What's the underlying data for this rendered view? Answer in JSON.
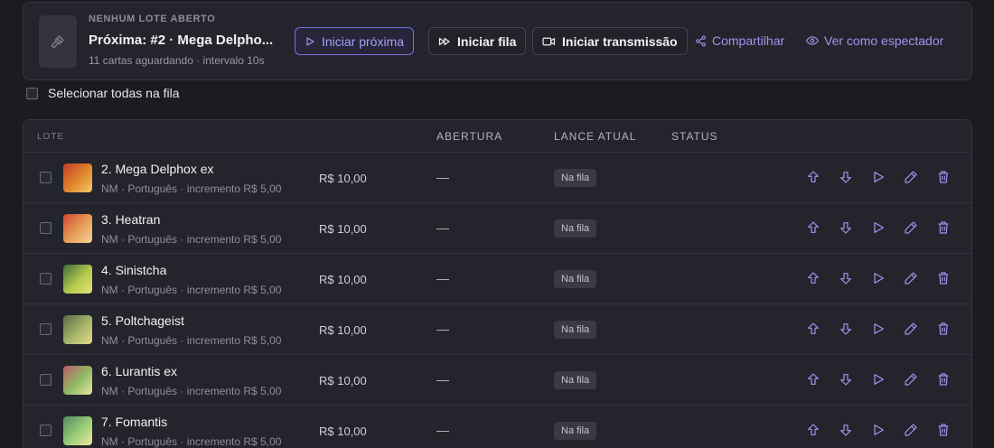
{
  "header": {
    "status_kicker": "NENHUM LOTE ABERTO",
    "next_title": "Próxima: #2 · Mega Delpho...",
    "queue_info": "11 cartas aguardando · intervalo 10s",
    "buttons": {
      "start_next": "Iniciar próxima",
      "start_queue": "Iniciar fila",
      "start_stream": "Iniciar transmissão"
    },
    "links": {
      "share": "Compartilhar",
      "view_as_viewer": "Ver como espectador"
    }
  },
  "select_all_label": "Selecionar todas na fila",
  "table": {
    "headers": {
      "lote": "LOTE",
      "abertura": "ABERTURA",
      "lance_atual": "LANCE ATUAL",
      "status": "STATUS"
    },
    "rows": [
      {
        "name": "2. Mega Delphox ex",
        "meta": "NM · Português · incremento R$ 5,00",
        "price": "R$ 10,00",
        "opening": "—",
        "status": "Na fila",
        "thumb_colors": [
          "#c23b2a",
          "#e08a2c",
          "#f3c96b"
        ]
      },
      {
        "name": "3. Heatran",
        "meta": "NM · Português · incremento R$ 5,00",
        "price": "R$ 10,00",
        "opening": "—",
        "status": "Na fila",
        "thumb_colors": [
          "#d1472f",
          "#e7a05a",
          "#f2d39a"
        ]
      },
      {
        "name": "4. Sinistcha",
        "meta": "NM · Português · incremento R$ 5,00",
        "price": "R$ 10,00",
        "opening": "—",
        "status": "Na fila",
        "thumb_colors": [
          "#3d6b3b",
          "#b7c94b",
          "#e6e07a"
        ]
      },
      {
        "name": "5. Poltchageist",
        "meta": "NM · Português · incremento R$ 5,00",
        "price": "R$ 10,00",
        "opening": "—",
        "status": "Na fila",
        "thumb_colors": [
          "#5a6a4a",
          "#a8b66a",
          "#e2d98a"
        ]
      },
      {
        "name": "6. Lurantis ex",
        "meta": "NM · Português · incremento R$ 5,00",
        "price": "R$ 10,00",
        "opening": "—",
        "status": "Na fila",
        "thumb_colors": [
          "#b85a6a",
          "#8ebd63",
          "#efe2a8"
        ]
      },
      {
        "name": "7. Fomantis",
        "meta": "NM · Português · incremento R$ 5,00",
        "price": "R$ 10,00",
        "opening": "—",
        "status": "Na fila",
        "thumb_colors": [
          "#4f8a63",
          "#9ccf76",
          "#f1e6a0"
        ]
      }
    ]
  },
  "colors": {
    "accent": "#9f95ee",
    "background": "#1b1b22",
    "card": "#24242c",
    "border": "#35353f"
  },
  "icons": {
    "lot": "gavel-icon",
    "start_next": "play-outline-icon",
    "start_queue": "fast-forward-icon",
    "start_stream": "video-camera-icon",
    "share": "share-icon",
    "view": "eye-icon",
    "row_actions": [
      "arrow-up-icon",
      "arrow-down-icon",
      "play-icon",
      "edit-pencil-icon",
      "trash-icon"
    ]
  }
}
